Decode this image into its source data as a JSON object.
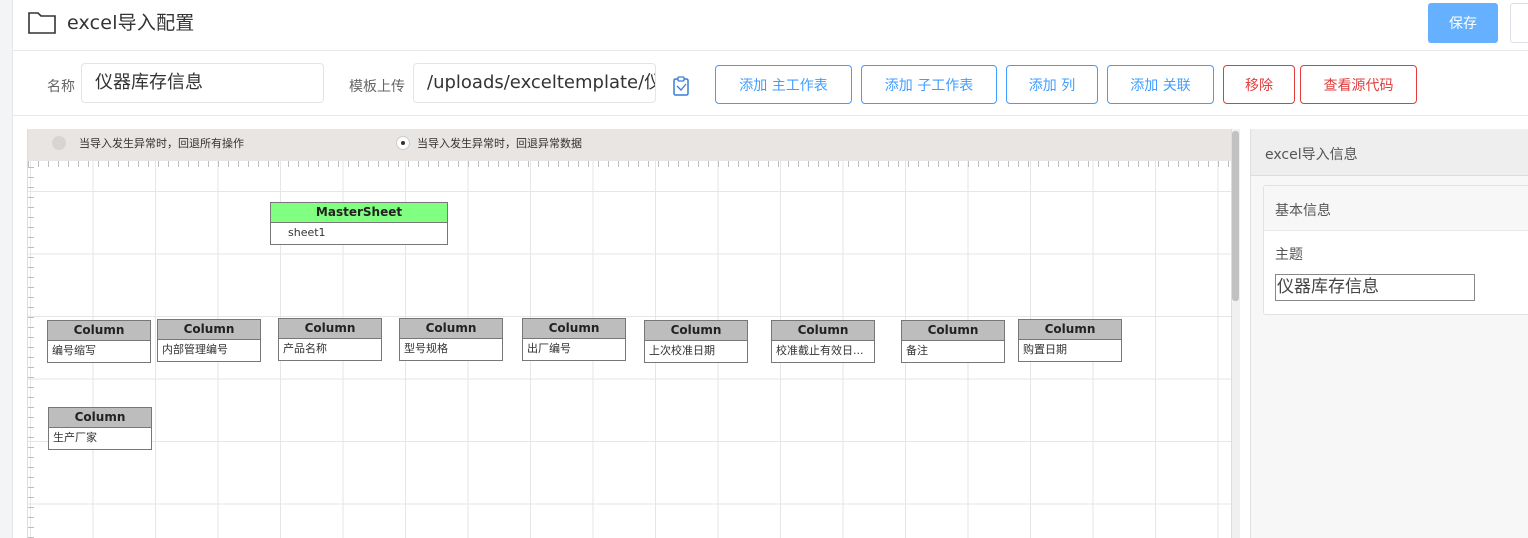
{
  "header": {
    "title": "excel导入配置",
    "save_label": "保存",
    "icon": "folder-icon"
  },
  "toolbar": {
    "name_label": "名称",
    "name_value": "仪器库存信息",
    "template_label": "模板上传",
    "template_value": "/uploads/exceltemplate/仪器库存信息",
    "buttons": {
      "add_main_sheet": "添加 主工作表",
      "add_sub_sheet": "添加 子工作表",
      "add_column": "添加 列",
      "add_relation": "添加 关联",
      "remove": "移除",
      "view_source": "查看源代码"
    }
  },
  "canvas": {
    "options": [
      "当导入发生异常时，回退所有操作",
      "当导入发生异常时，回退异常数据"
    ],
    "selected_option": 1,
    "master": {
      "header": "MasterSheet",
      "value": "sheet1"
    },
    "column_header": "Column",
    "columns": [
      "编号缩写",
      "内部管理编号",
      "产品名称",
      "型号规格",
      "出厂编号",
      "上次校准日期",
      "校准截止有效日...",
      "备注",
      "购置日期",
      "生产厂家"
    ]
  },
  "panel": {
    "title": "excel导入信息",
    "section_title": "基本信息",
    "subject_label": "主题",
    "subject_value": "仪器库存信息"
  }
}
